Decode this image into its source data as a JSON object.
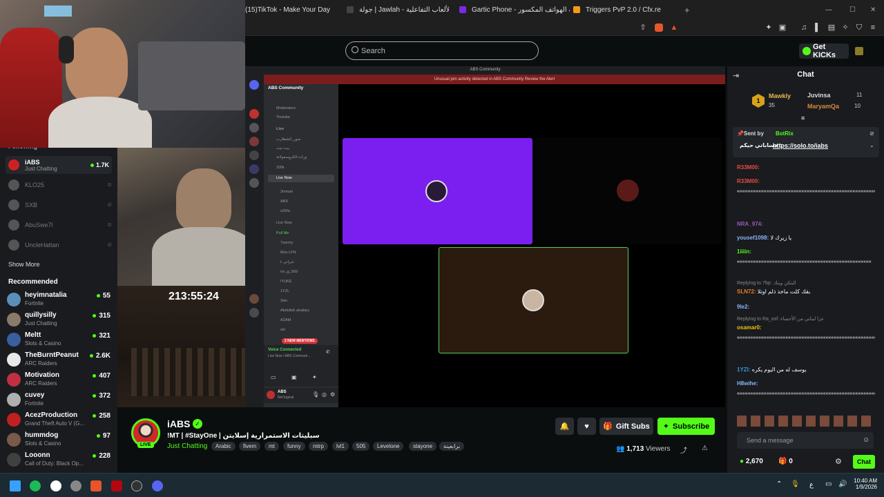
{
  "browser": {
    "tabs": [
      {
        "label": "(15)TikTok - Make Your Day",
        "color": "#111111"
      },
      {
        "label": "جولة | Jawlah - منصة الألعاب التفاعلية",
        "color": "#222222"
      },
      {
        "label": "Gartic Phone - لعبة الهواتف المكسور",
        "color": "#7a2be2"
      },
      {
        "label": "Triggers PvP 2.0 / Cfx.re",
        "color": "#f39c12"
      }
    ]
  },
  "header": {
    "search_placeholder": "Search",
    "get_kicks_label": "Get KICKs"
  },
  "sidebar": {
    "following_heading": "Following",
    "following": [
      {
        "name": "iABS",
        "category": "Just Chatting",
        "viewers": "1.7K",
        "live": true
      },
      {
        "name": "KLO25",
        "live": false
      },
      {
        "name": "SXB",
        "live": false
      },
      {
        "name": "AbuSwe7l",
        "live": false
      },
      {
        "name": "UncleHattan",
        "live": false
      }
    ],
    "show_more_label": "Show More",
    "recommended_heading": "Recommended",
    "recommended": [
      {
        "name": "heyimnatalia",
        "category": "Fortnite",
        "viewers": "55",
        "color": "#5a8fb8"
      },
      {
        "name": "quillysilly",
        "category": "Just Chatting",
        "viewers": "315",
        "color": "#8a7a6a"
      },
      {
        "name": "Meltt",
        "category": "Slots & Casino",
        "viewers": "321",
        "color": "#3a5fa0"
      },
      {
        "name": "TheBurntPeanut",
        "category": "ARC Raiders",
        "viewers": "2.6K",
        "color": "#e8e8e8"
      },
      {
        "name": "Motivation",
        "category": "ARC Raiders",
        "viewers": "407",
        "color": "#c03040"
      },
      {
        "name": "cuvey",
        "category": "Fortnite",
        "viewers": "372",
        "color": "#b0b0b0"
      },
      {
        "name": "AcezProduction",
        "category": "Grand Theft Auto V (G...",
        "viewers": "258",
        "color": "#c02020"
      },
      {
        "name": "hummdog",
        "category": "Slots & Casino",
        "viewers": "97",
        "color": "#7a5a4a"
      },
      {
        "name": "Looonn",
        "category": "Call of Duty: Black Op...",
        "viewers": "228",
        "color": "#404040"
      }
    ]
  },
  "player": {
    "timer": "213:55:24",
    "discord_title": "ABS Community",
    "discord_alert": "Unusual join activity detected in ABS Community     Review the Alert",
    "discord_server": "ABS Community",
    "discord_channels": [
      "Moderators",
      "Youtube",
      "Live",
      "صور_الشطارب",
      "بيت-نيت",
      "ورات-الكروسمولانة",
      "100k",
      "Live Now",
      "3mmari",
      "ABS",
      "o25fa",
      "Live Now",
      "Pull Me",
      "7oermy",
      "Mos LFN",
      "L عبراني",
      "mr_g_999",
      "IYUKE",
      "1YZL",
      "3sin",
      "Abdullah alsalary",
      "AZAM",
      "sin"
    ],
    "discord_new_mentions": "2 NEW MENTIONS",
    "voice_connected": "Voice Connected",
    "voice_channel": "Live Now / ABS Communi...",
    "discord_user": "ABS",
    "discord_user_status": "Not logical"
  },
  "stream": {
    "streamer": "iABS",
    "live_label": "LIVE",
    "title": "!MT | #StayOne | سبليتات الاستمرارية إسلايتن",
    "category": "Just Chatting",
    "tags": [
      "Arabic",
      "fivem",
      "mt",
      "funny",
      "mtrp",
      "lvl1",
      "505",
      "Levelone",
      "stayone",
      "برابعينة"
    ],
    "gift_subs_label": "Gift Subs",
    "subscribe_label": "Subscribe",
    "viewers": "1,713",
    "viewers_label": "Viewers"
  },
  "chat": {
    "title": "Chat",
    "leaderboard": [
      {
        "name": "Mawkly",
        "count": "35",
        "rank": "1"
      },
      {
        "name": "Juvinsa",
        "count": "11"
      },
      {
        "name": "MaryamQa",
        "count": "10"
      }
    ],
    "pinned_sender_label": "Sent by",
    "pinned_sender": "BotRix",
    "pinned_message": "حساباتي حيكم :",
    "pinned_link": "https://solo.to/iabs",
    "messages": [
      {
        "user": "R33M00:",
        "text": "",
        "color": "#e74c3c"
      },
      {
        "user": "R33M00:",
        "text": "",
        "color": "#e74c3c"
      },
      {
        "user": "",
        "text": "«««««««««««««««««««««««««««««««««««««««««««««««««««««««««««««««««««««««««",
        "color": "#ffffff"
      },
      {
        "user": "NRA_974:",
        "text": "",
        "color": "#9b59b6"
      },
      {
        "user": "yousef1098:",
        "text": "يا زيرك لا",
        "color": "#8ab4f8"
      },
      {
        "user": "1iiiin:",
        "text": "",
        "color": "#53fc18"
      },
      {
        "user": "",
        "text": "««««««««««««««««««««««««««««««««««««««««««««««««««",
        "color": "#ffffff"
      },
      {
        "user": "SLN72:",
        "text": "بقك كلت ماخذ ذلم اوتلا",
        "color": "#e67e22"
      },
      {
        "user": "9le2:",
        "text": "",
        "color": "#8ab4f8"
      },
      {
        "user": "osamar0:",
        "text": "",
        "color": "#f1c40f"
      },
      {
        "user": "",
        "text": "«««««««««««««««««««««««««««««««««««««««««««««««««««««««««««««««««««««««««",
        "color": "#ffffff"
      },
      {
        "user": "1YZl:",
        "text": "يوسف له من اليوم يكره",
        "color": "#3498db"
      },
      {
        "user": "H8wihe:",
        "text": "",
        "color": "#8ab4f8"
      },
      {
        "user": "",
        "text": "«««««««««««««««««««««««««««««««««««««««««««««««««««««««««««««««««««««",
        "color": "#ffffff"
      }
    ],
    "replies": [
      "Replying to 7fqr: البتكن وينك",
      "Replying to Ra_osf: عزا لبناني من الأحساء"
    ],
    "input_placeholder": "Send a message",
    "kicks_balance": "2,670",
    "gift_count": "0",
    "send_label": "Chat"
  },
  "taskbar": {
    "lang": "ع",
    "time": "10:40 AM",
    "date": "1/9/2026"
  },
  "colors": {
    "kick_green": "#53fc18",
    "stage_purple": "#7b1ff0",
    "stage_brown": "#2b1a0e"
  }
}
